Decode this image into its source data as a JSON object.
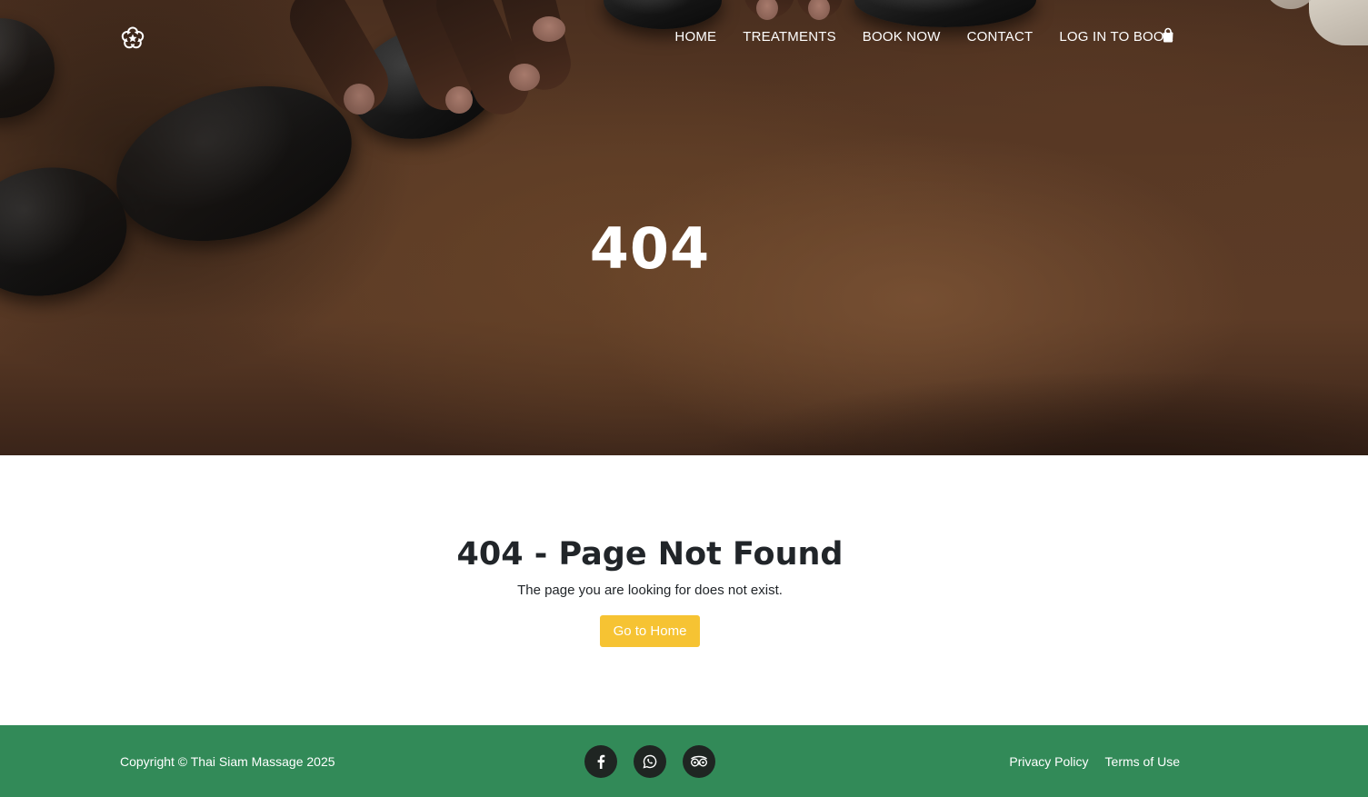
{
  "header": {
    "logo_icon": "flower-icon",
    "nav": [
      {
        "label": "HOME"
      },
      {
        "label": "TREATMENTS"
      },
      {
        "label": "BOOK NOW"
      },
      {
        "label": "CONTACT"
      },
      {
        "label": "LOG IN TO BOOK"
      }
    ],
    "cart_icon": "shopping-bag-icon"
  },
  "hero": {
    "title": "404"
  },
  "main": {
    "title": "404 - Page Not Found",
    "description": "The page you are looking for does not exist.",
    "button_label": "Go to Home",
    "button_color": "#f6c333"
  },
  "footer": {
    "copyright": "Copyright © Thai Siam Massage 2025",
    "background_color": "#328a58",
    "social": [
      {
        "icon": "facebook-icon"
      },
      {
        "icon": "whatsapp-icon"
      },
      {
        "icon": "tripadvisor-icon"
      }
    ],
    "links": [
      {
        "label": "Privacy Policy"
      },
      {
        "label": "Terms of Use"
      }
    ]
  }
}
